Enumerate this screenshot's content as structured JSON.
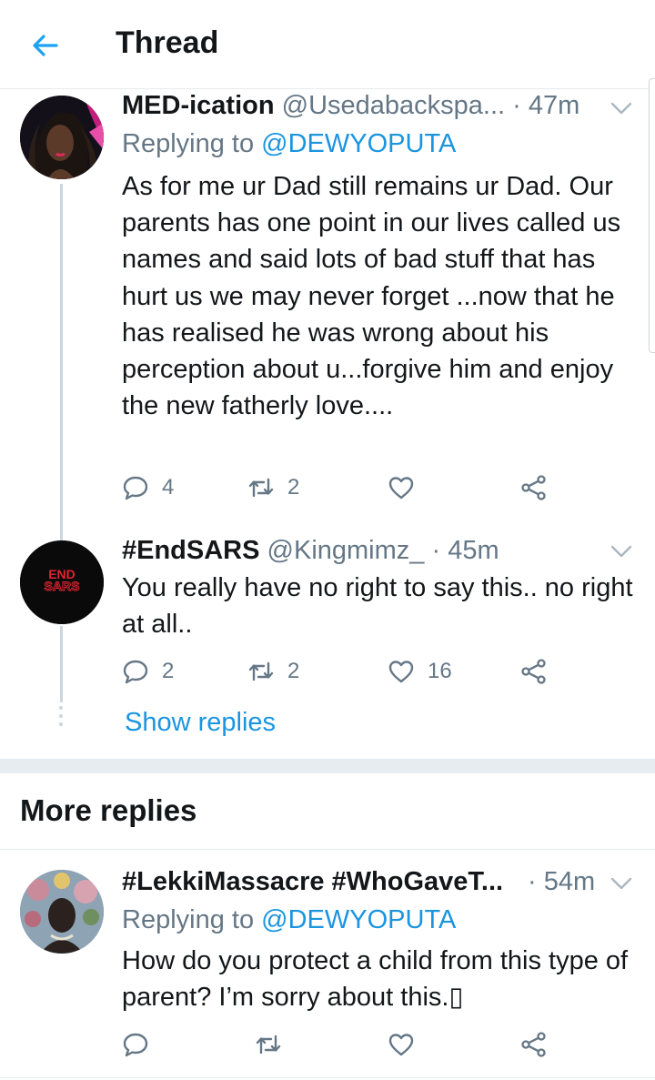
{
  "header": {
    "title": "Thread"
  },
  "tweets": [
    {
      "display_name": "MED-ication",
      "handle": "@Usedabackspa...",
      "time": "· 47m",
      "replying_label": "Replying to",
      "replying_to": "@DEWYOPUTA",
      "text": "As for me ur Dad still remains ur Dad. Our parents has one point in our lives called us names and said lots of bad stuff that has hurt us we may never forget ...now that he has realised he was wrong about his perception about u...forgive him and enjoy the new fatherly love....",
      "reply_count": "4",
      "retweet_count": "2",
      "like_count": ""
    },
    {
      "display_name": "#EndSARS",
      "handle": "@Kingmimz_",
      "time": "· 45m",
      "avatar_text_top": "END",
      "avatar_text_bottom": "SARS",
      "text": "You really have no right to say this.. no right at all..",
      "reply_count": "2",
      "retweet_count": "2",
      "like_count": "16"
    },
    {
      "display_name": "#LekkiMassacre #WhoGaveT...",
      "handle": "",
      "time": "· 54m",
      "replying_label": "Replying to",
      "replying_to": "@DEWYOPUTA",
      "text": "How do you protect a child from this type of parent? I’m sorry about this.▯",
      "reply_count": "",
      "retweet_count": "",
      "like_count": ""
    }
  ],
  "show_replies": "Show replies",
  "more_replies_title": "More replies",
  "colors": {
    "accent": "#1b95e0",
    "muted": "#657786",
    "text": "#14171a",
    "border": "#e6ecf0",
    "endsars_red": "#e0242f"
  },
  "icons": [
    "back-arrow-icon",
    "chevron-down-icon",
    "reply-icon",
    "retweet-icon",
    "like-icon",
    "share-icon"
  ]
}
